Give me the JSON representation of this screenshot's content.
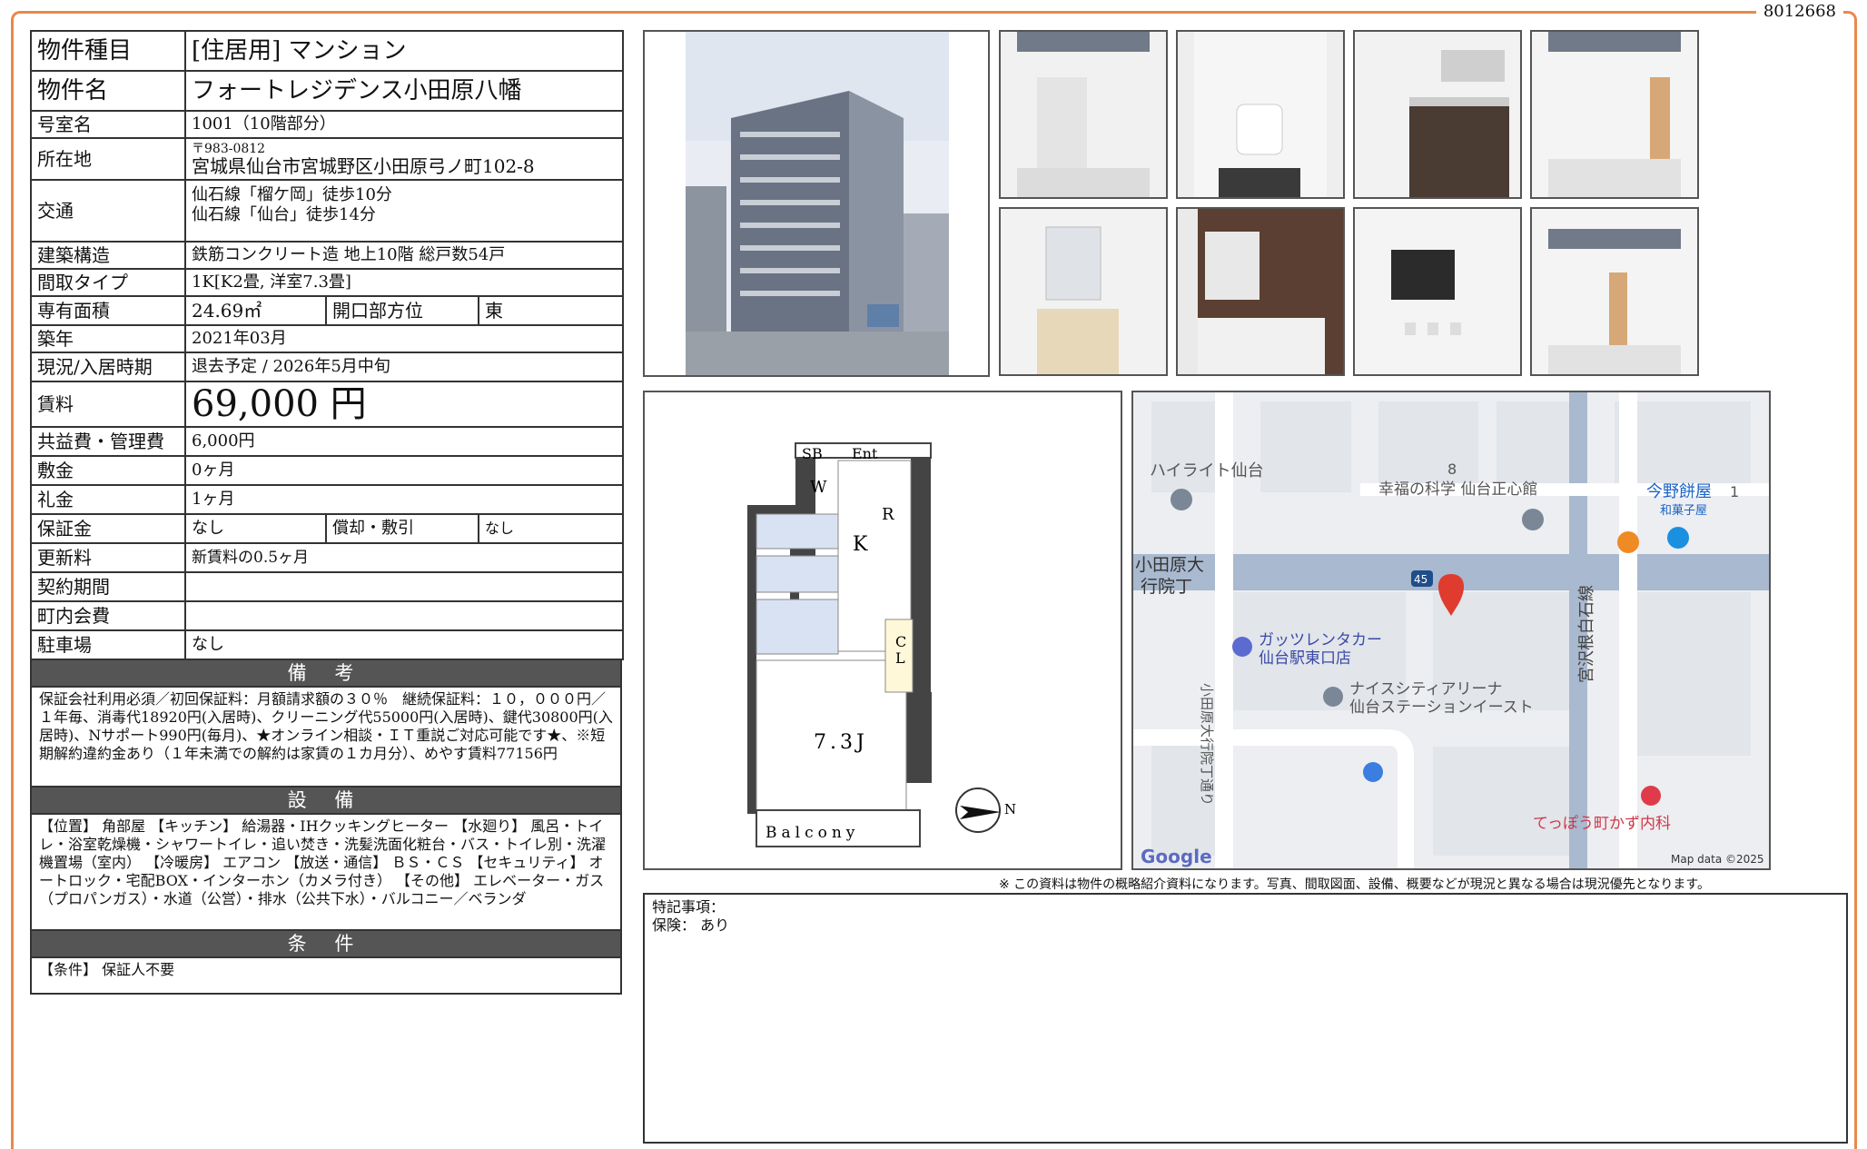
{
  "doc_id": "8012668",
  "rows": {
    "type_label": "物件種目",
    "type_value": "[住居用] マンション",
    "name_label": "物件名",
    "name_value": "フォートレジデンス小田原八幡",
    "room_label": "号室名",
    "room_value": "1001（10階部分）",
    "address_label": "所在地",
    "address_zip": "〒983-0812",
    "address_value": "宮城県仙台市宮城野区小田原弓ノ町102-8",
    "transit_label": "交通",
    "transit_1": "仙石線「榴ケ岡」徒歩10分",
    "transit_2": "仙石線「仙台」徒歩14分",
    "structure_label": "建築構造",
    "structure_value": "鉄筋コンクリート造 地上10階 総戸数54戸",
    "layout_label": "間取タイプ",
    "layout_value": "1K[K2畳, 洋室7.3畳]",
    "area_label": "専有面積",
    "area_value": "24.69㎡",
    "facing_label": "開口部方位",
    "facing_value": "東",
    "built_label": "築年",
    "built_value": "2021年03月",
    "status_label": "現況/入居時期",
    "status_value": "退去予定 / 2026年5月中旬",
    "rent_label": "賃料",
    "rent_value": "69,000 円",
    "fee_label": "共益費・管理費",
    "fee_value": "6,000円",
    "deposit_label": "敷金",
    "deposit_value": "0ヶ月",
    "key_label": "礼金",
    "key_value": "1ヶ月",
    "guarantee_label": "保証金",
    "guarantee_value": "なし",
    "amort_label": "償却・敷引",
    "amort_value": "なし",
    "renew_label": "更新料",
    "renew_value": "新賃料の0.5ヶ月",
    "contract_label": "契約期間",
    "contract_value": "",
    "town_label": "町内会費",
    "town_value": "",
    "parking_label": "駐車場",
    "parking_value": "なし"
  },
  "remarks": {
    "title": "備 考",
    "text": "保証会社利用必須／初回保証料：月額請求額の３０％　継続保証料：１０，０００円／１年毎、消毒代18920円(入居時)、クリーニング代55000円(入居時)、鍵代30800円(入居時)、Nサポート990円(毎月)、★オンライン相談・ＩＴ重説ご対応可能です★、※短期解約違約金あり（１年未満での解約は家賃の１カ月分）、めやす賃料77156円"
  },
  "equipment": {
    "title": "設 備",
    "text": "【位置】 角部屋 【キッチン】 給湯器・IHクッキングヒーター 【水廻り】 風呂・トイレ・浴室乾燥機・シャワートイレ・追い焚き・洗髪洗面化粧台・バス・トイレ別・洗濯機置場（室内） 【冷暖房】 エアコン 【放送・通信】 ＢＳ・ＣＳ 【セキュリティ】 オートロック・宅配BOX・インターホン（カメラ付き） 【その他】 エレベーター・ガス（プロパンガス）・水道（公営）・排水（公共下水）・バルコニー／ベランダ"
  },
  "conditions": {
    "title": "条 件",
    "text": "【条件】 保証人不要"
  },
  "floorplan": {
    "labels": [
      "SB",
      "Ent",
      "W",
      "R",
      "K",
      "C",
      "L",
      "7.3J",
      "Balcony",
      "N"
    ]
  },
  "map": {
    "labels": [
      "ハイライト仙台",
      "8",
      "幸福の科学 仙台正心館",
      "今野餅屋",
      "和菓子屋",
      "1",
      "小田原大",
      "行院丁",
      "45",
      "ガッツレンタカー",
      "仙台駅東口店",
      "ナイスシティアリーナ",
      "仙台ステーションイースト",
      "小田原大行院丁通り",
      "宮沢根白石線",
      "てっぽう町かず内科",
      "Google",
      "Map data ©2025"
    ]
  },
  "note": "※ この資料は物件の概略紹介資料になります。写真、間取図面、設備、概要などが現況と異なる場合は現況優先となります。",
  "special": {
    "title": "特記事項：",
    "insurance": "保険： あり"
  }
}
